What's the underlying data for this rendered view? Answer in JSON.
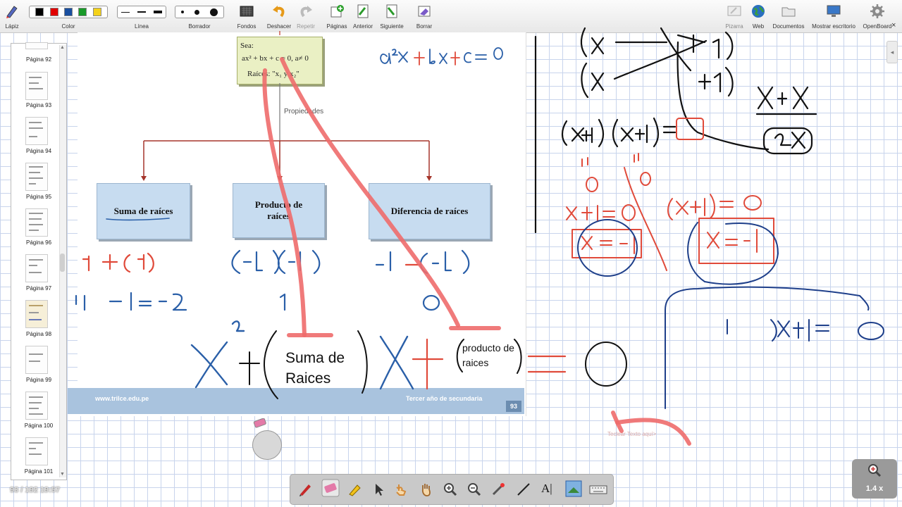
{
  "toolbar": {
    "lapiz": "Lápiz",
    "color": "Color",
    "linea": "Línea",
    "borrador": "Borrador",
    "fondos": "Fondos",
    "deshacer": "Deshacer",
    "repetir": "Repetir",
    "paginas": "Páginas",
    "anterior": "Anterior",
    "siguiente": "Siguiente",
    "borrar": "Borrar",
    "pizarra": "Pizarra",
    "web": "Web",
    "documentos": "Documentos",
    "mostrar_escritorio": "Mostrar escritorio",
    "openboard": "OpenBoard",
    "colors": [
      "#000000",
      "#e00000",
      "#1a4fa0",
      "#1a9a2a",
      "#f4d21a"
    ]
  },
  "pages": [
    {
      "label": "Página 92"
    },
    {
      "label": "Página 93"
    },
    {
      "label": "Página 94"
    },
    {
      "label": "Página 95"
    },
    {
      "label": "Página 96"
    },
    {
      "label": "Página 97"
    },
    {
      "label": "Página 98"
    },
    {
      "label": "Página 99"
    },
    {
      "label": "Página 100"
    },
    {
      "label": "Página 101"
    }
  ],
  "document": {
    "sea_title": "Sea:",
    "sea_equation": "ax² + bx + c = 0, a≠ 0",
    "sea_roots": "Raíces: \"x₁ y x₂\"",
    "propiedades": "Propiedades",
    "suma": "Suma de raíces",
    "producto": "Producto de raíces",
    "diferencia": "Diferencia de raíces",
    "footer_url": "www.trilce.edu.pe",
    "footer_grade": "Tercer año de secundaria",
    "footer_page": "93"
  },
  "textbox": {
    "text1": "Suma de",
    "text2": "Raices",
    "text3": "producto de",
    "text4": "raices",
    "placeholder": "Teclear Texto aquí>"
  },
  "status": "93 / 192 19:57",
  "zoom": "1.4 x"
}
